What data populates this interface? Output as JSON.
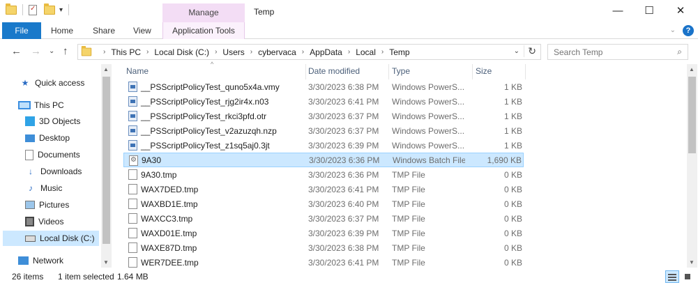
{
  "window": {
    "title": "Temp",
    "manage_label": "Manage",
    "minimize": "—",
    "maximize": "☐",
    "close": "✕"
  },
  "ribbon": {
    "file": "File",
    "home": "Home",
    "share": "Share",
    "view": "View",
    "app_tools": "Application Tools",
    "expand": "⌄",
    "help": "?"
  },
  "address": {
    "back": "←",
    "forward": "→",
    "recent": "⌄",
    "up": "↑",
    "crumbs": [
      "This PC",
      "Local Disk (C:)",
      "Users",
      "cybervaca",
      "AppData",
      "Local",
      "Temp"
    ],
    "crumb_sep": "›",
    "dropdown": "⌄",
    "refresh": "↻",
    "search_placeholder": "Search Temp",
    "search_icon": "⌕"
  },
  "nav": {
    "items": [
      {
        "label": "Quick access",
        "icon": "star-icon"
      },
      {
        "label": "This PC",
        "icon": "computer-icon"
      },
      {
        "label": "3D Objects",
        "icon": "cube-icon"
      },
      {
        "label": "Desktop",
        "icon": "desktop-icon"
      },
      {
        "label": "Documents",
        "icon": "document-icon"
      },
      {
        "label": "Downloads",
        "icon": "download-icon"
      },
      {
        "label": "Music",
        "icon": "music-icon"
      },
      {
        "label": "Pictures",
        "icon": "picture-icon"
      },
      {
        "label": "Videos",
        "icon": "video-icon"
      },
      {
        "label": "Local Disk (C:)",
        "icon": "drive-icon"
      },
      {
        "label": "Network",
        "icon": "network-icon"
      }
    ],
    "selected": "Local Disk (C:)"
  },
  "columns": {
    "name": "Name",
    "date": "Date modified",
    "type": "Type",
    "size": "Size",
    "sort_indicator": "^"
  },
  "files": [
    {
      "name": "__PSScriptPolicyTest_quno5x4a.vmy",
      "date": "3/30/2023 6:38 PM",
      "type": "Windows PowerS...",
      "size": "1 KB",
      "icon": "ps"
    },
    {
      "name": "__PSScriptPolicyTest_rjg2ir4x.n03",
      "date": "3/30/2023 6:41 PM",
      "type": "Windows PowerS...",
      "size": "1 KB",
      "icon": "ps"
    },
    {
      "name": "__PSScriptPolicyTest_rkci3pfd.otr",
      "date": "3/30/2023 6:37 PM",
      "type": "Windows PowerS...",
      "size": "1 KB",
      "icon": "ps"
    },
    {
      "name": "__PSScriptPolicyTest_v2azuzqh.nzp",
      "date": "3/30/2023 6:37 PM",
      "type": "Windows PowerS...",
      "size": "1 KB",
      "icon": "ps"
    },
    {
      "name": "__PSScriptPolicyTest_z1sq5aj0.3jt",
      "date": "3/30/2023 6:39 PM",
      "type": "Windows PowerS...",
      "size": "1 KB",
      "icon": "ps"
    },
    {
      "name": "9A30",
      "date": "3/30/2023 6:36 PM",
      "type": "Windows Batch File",
      "size": "1,690 KB",
      "icon": "gear",
      "selected": true
    },
    {
      "name": "9A30.tmp",
      "date": "3/30/2023 6:36 PM",
      "type": "TMP File",
      "size": "0 KB",
      "icon": "file"
    },
    {
      "name": "WAX7DED.tmp",
      "date": "3/30/2023 6:41 PM",
      "type": "TMP File",
      "size": "0 KB",
      "icon": "file"
    },
    {
      "name": "WAXBD1E.tmp",
      "date": "3/30/2023 6:40 PM",
      "type": "TMP File",
      "size": "0 KB",
      "icon": "file"
    },
    {
      "name": "WAXCC3.tmp",
      "date": "3/30/2023 6:37 PM",
      "type": "TMP File",
      "size": "0 KB",
      "icon": "file"
    },
    {
      "name": "WAXD01E.tmp",
      "date": "3/30/2023 6:39 PM",
      "type": "TMP File",
      "size": "0 KB",
      "icon": "file"
    },
    {
      "name": "WAXE87D.tmp",
      "date": "3/30/2023 6:38 PM",
      "type": "TMP File",
      "size": "0 KB",
      "icon": "file"
    },
    {
      "name": "WER7DEE.tmp",
      "date": "3/30/2023 6:41 PM",
      "type": "TMP File",
      "size": "0 KB",
      "icon": "file"
    }
  ],
  "status": {
    "count": "26 items",
    "selection": "1 item selected",
    "size": "1.64 MB"
  },
  "colors": {
    "accent": "#1979ca",
    "selection": "#cce8ff",
    "manage_tab": "#f3ddf5"
  }
}
